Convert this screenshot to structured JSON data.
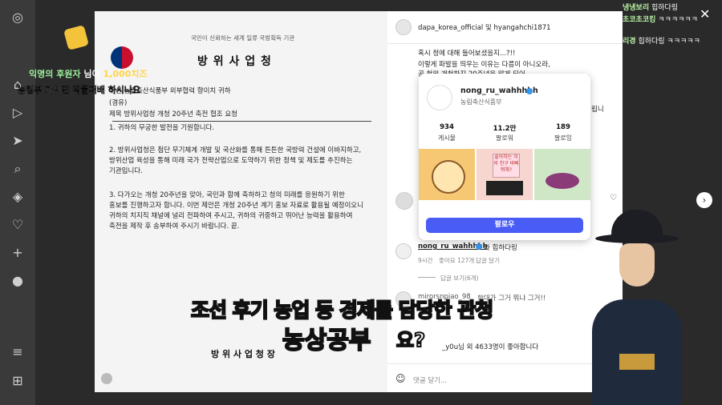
{
  "nav": {
    "icons": [
      "instagram-icon",
      "home-icon",
      "search-icon",
      "explore-icon",
      "reels-icon",
      "messages-icon",
      "notifications-icon",
      "create-icon",
      "profile-icon",
      "more-icon",
      "threads-icon"
    ]
  },
  "doc": {
    "motto": "국민이 신뢰하는 세계 일류 국방획득 기관",
    "title": "방 위 사 업 청",
    "recipient": "수신  농림축산식품부 외부협력 향이치 귀하",
    "via": "(경유)",
    "subject": "제목  방위사업청 개청 20주년 축전 협조 요청",
    "p1": "1.  귀하의 무궁한 발전을 기원합니다.",
    "p2": [
      "2.  방위사업청은 첨단 무기체계 개발 및 국산화를 통해 튼튼한 국방력 건설에 이바지하고,",
      "방위산업 육성을 통해 미래 국가 전략산업으로 도약하기 위한 정책 및 제도를 추진하는",
      "기관입니다."
    ],
    "p3": [
      "3.  다가오는 개청 20주년을 맞아, 국민과 함께 축하하고 청의 미래를 응원하기 위한",
      "홍보를 진행하고자 합니다. 이번 제안은 개청 20주년 계기 홍보 자료로 활용될 예정이오니",
      "귀하의 치지직 채널에 널리 전파하여 주시고, 귀하의 귀중하고 뛰어난 능력을 활용하여",
      "축전을 제작 후 송부하여 주시기 바랍니다.   끝."
    ],
    "signature": "방 위 사 업 청 장"
  },
  "panel": {
    "header": "dapa_korea_official 및 hyangahchi1871",
    "text1": "혹시 청에 대해 들어보셨을지...?!!",
    "text2": "이렇게 파발을 띄우는 이유는 다름이 아니오라,",
    "text3": "공 청의 개청하지 20주년을 맞게 되어",
    "text4": "립니",
    "comment_user": "nong_ru_wahhhhh",
    "comment_text": "와 힙하다링",
    "comment_meta": [
      "9시간",
      "좋아요 127개",
      "답글 달기"
    ],
    "replies": "답글 보기(6개)",
    "comment2_user": "mirorsnpiao_98",
    "comment2_text": "한대가 그거 뭐냐 그거!!",
    "likes": "_y0u님 외 4633명이 좋아합니다",
    "add_comment": "댓글 달기..."
  },
  "card": {
    "username": "nong_ru_wahhhhh",
    "fullname": "농림축산식품부",
    "stats": [
      {
        "n": "934",
        "l": "게시물"
      },
      {
        "n": "11.2만",
        "l": "팔로워"
      },
      {
        "n": "189",
        "l": "팔로잉"
      }
    ],
    "follow": "팔로우",
    "thumb_text": "좋아하는 이의 친구 바빠 뭐해?"
  },
  "chat": [
    {
      "name": "냉냉보리",
      "msg": "힙하다링"
    },
    {
      "name": "초코초코킹",
      "msg": "ㅋㅋㅋㅋㅋㅋ"
    },
    {
      "name": "리경",
      "msg": "힙하다링 ㅋㅋㅋㅋㅋ"
    }
  ],
  "donation": {
    "name": "익명의 후원자",
    "suffix": "님이",
    "amount": "1,000치즈",
    "msg": "농림부 가시면 작물재배 하시나요"
  },
  "subtitle": {
    "line1": "조선 후기 농업 등 경제를 담당한 관청",
    "line2": "농상공부",
    "line2_suffix": "요?"
  },
  "colors": {
    "follow": "#4a5cf6",
    "subtitle": "#fff34a"
  }
}
